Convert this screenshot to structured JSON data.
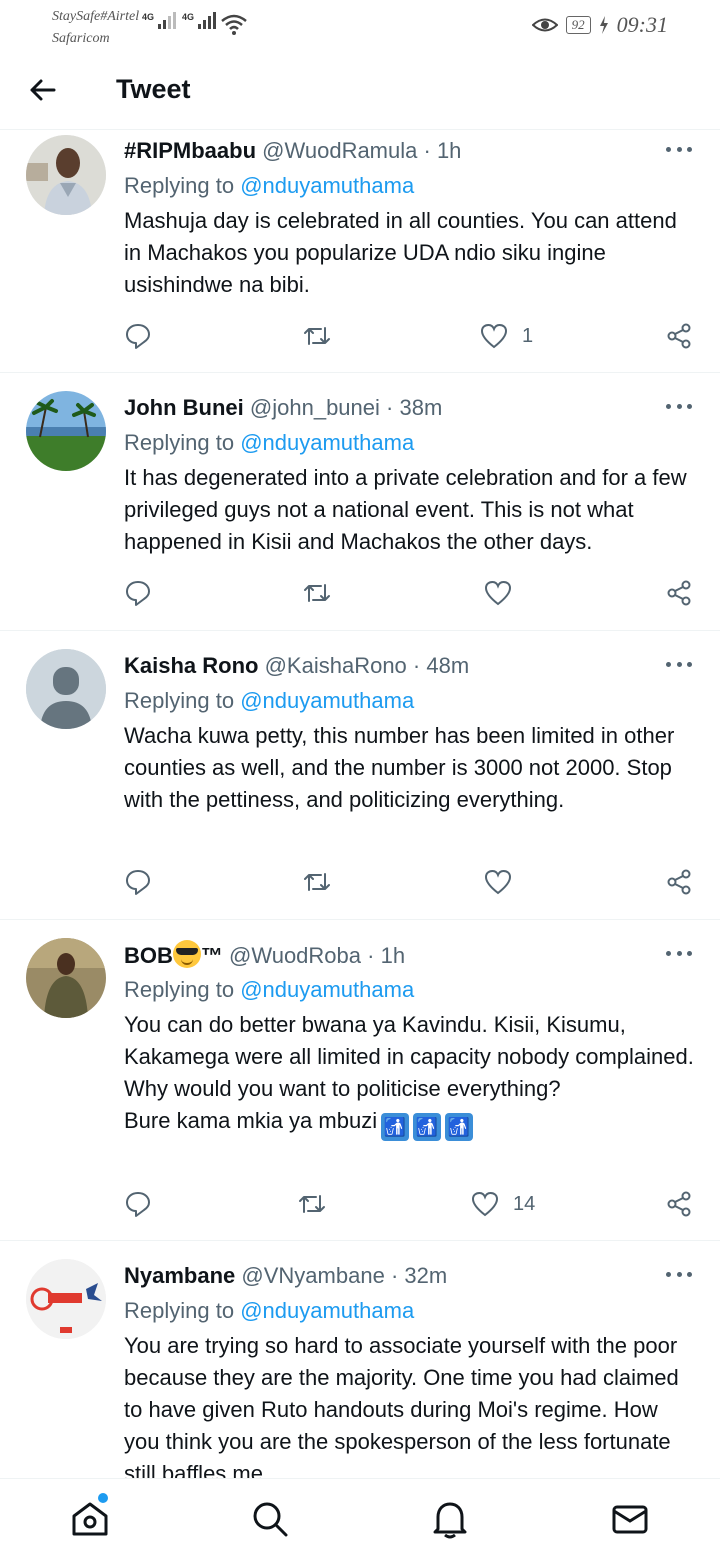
{
  "status_bar": {
    "carrier_line1": "StaySafe#Airtel",
    "carrier_line2": "Safaricom",
    "network1": "4G",
    "network2": "4G",
    "battery": "92",
    "time": "09:31"
  },
  "header": {
    "title": "Tweet"
  },
  "tweets": [
    {
      "name": "#RIPMbaabu",
      "handle": "@WuodRamula",
      "time": "· 1h",
      "replying_label": "Replying to",
      "replying_to": "@nduyamuthama",
      "text": "Mashuja day is celebrated in all counties. You can attend in Machakos you popularize UDA ndio siku ingine usishindwe na bibi.",
      "likes": "1"
    },
    {
      "name": "John Bunei",
      "handle": "@john_bunei",
      "time": "· 38m",
      "replying_label": "Replying to",
      "replying_to": "@nduyamuthama",
      "text": "It has degenerated into a private celebration and for a few privileged guys not a national event. This is not what happened in Kisii and Machakos the other days.",
      "likes": ""
    },
    {
      "name": "Kaisha Rono",
      "handle": "@KaishaRono",
      "time": "· 48m",
      "replying_label": "Replying to",
      "replying_to": "@nduyamuthama",
      "text": "Wacha kuwa petty, this number has been limited in other counties as well, and the number is 3000 not 2000. Stop with the pettiness, and politicizing everything.",
      "likes": ""
    },
    {
      "name": "BOB",
      "name_suffix": "™",
      "handle": "@WuodRoba",
      "time": "· 1h",
      "replying_label": "Replying to",
      "replying_to": "@nduyamuthama",
      "text": "You can do better bwana ya Kavindu. Kisii, Kisumu, Kakamega were all limited in capacity nobody complained. Why would you want to politicise everything?",
      "text2": "Bure kama mkia ya mbuzi",
      "likes": "14"
    },
    {
      "name": "Nyambane",
      "handle": "@VNyambane",
      "time": "· 32m",
      "replying_label": "Replying to",
      "replying_to": "@nduyamuthama",
      "text": "You are trying so hard to associate yourself with the poor because they are the majority. One time you had claimed to have given Ruto handouts during Moi's regime. How you think you are the spokesperson of the less fortunate still baffles me",
      "likes": ""
    }
  ],
  "icons": {
    "back": "arrow-left-icon",
    "reply": "reply-icon",
    "retweet": "retweet-icon",
    "like": "heart-icon",
    "share": "share-icon",
    "nav": [
      "home-icon",
      "search-icon",
      "notifications-icon",
      "messages-icon"
    ]
  },
  "colors": {
    "accent": "#1d9bf0",
    "text": "#0f1419",
    "secondary": "#536471"
  }
}
